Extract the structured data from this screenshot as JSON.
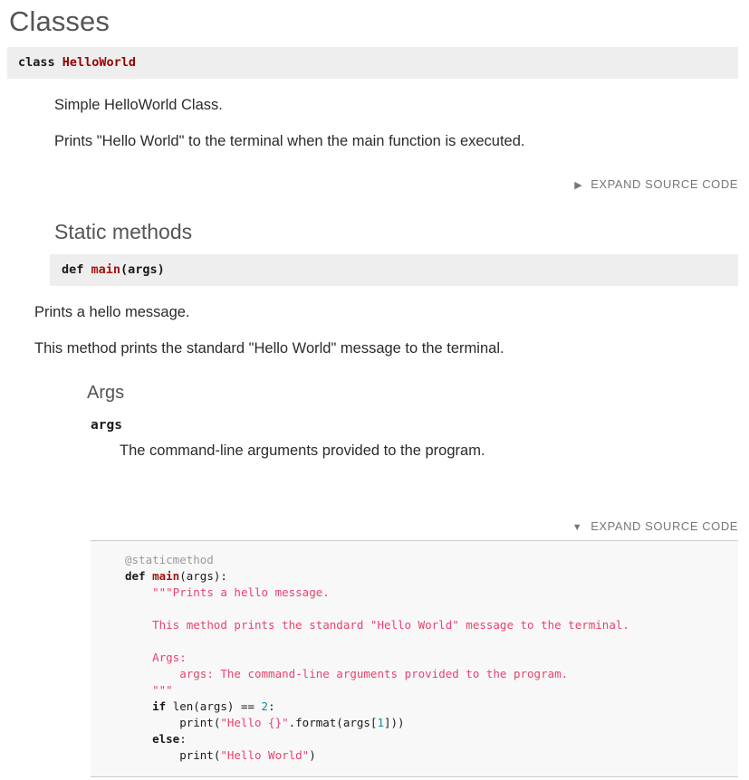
{
  "page": {
    "title": "Classes"
  },
  "class_entry": {
    "signature": {
      "keyword": "class",
      "name": "HelloWorld"
    },
    "descriptions": [
      "Simple HelloWorld Class.",
      "Prints \"Hello World\" to the terminal when the main function is executed."
    ],
    "expand_toggle": {
      "label": "EXPAND SOURCE CODE",
      "triangle": "collapsed-triangle-icon",
      "glyph": "▶",
      "expanded": false
    }
  },
  "static_methods": {
    "heading": "Static methods",
    "method": {
      "signature": {
        "keyword": "def",
        "name": "main",
        "params": "(args)"
      },
      "descriptions": [
        "Prints a hello message.",
        "This method prints the standard \"Hello World\" message to the terminal."
      ],
      "args_heading": "Args",
      "args": [
        {
          "name": "args",
          "description": "The command-line arguments provided to the program."
        }
      ],
      "expand_toggle": {
        "label": "EXPAND SOURCE CODE",
        "triangle": "expanded-triangle-icon",
        "glyph": "▼",
        "expanded": true
      },
      "source_code": {
        "lines": [
          {
            "tokens": [
              {
                "t": "@staticmethod",
                "c": "decorator"
              }
            ]
          },
          {
            "tokens": [
              {
                "t": "def ",
                "c": "kw"
              },
              {
                "t": "main",
                "c": "fn"
              },
              {
                "t": "(args):",
                "c": "plain"
              }
            ]
          },
          {
            "tokens": [
              {
                "t": "    ",
                "c": "plain"
              },
              {
                "t": "\"\"\"Prints a hello message.",
                "c": "doc"
              }
            ]
          },
          {
            "tokens": [
              {
                "t": "",
                "c": "plain"
              }
            ]
          },
          {
            "tokens": [
              {
                "t": "    ",
                "c": "plain"
              },
              {
                "t": "This method prints the standard \"Hello World\" message to the terminal.",
                "c": "doc"
              }
            ]
          },
          {
            "tokens": [
              {
                "t": "",
                "c": "plain"
              }
            ]
          },
          {
            "tokens": [
              {
                "t": "    ",
                "c": "plain"
              },
              {
                "t": "Args:",
                "c": "doc"
              }
            ]
          },
          {
            "tokens": [
              {
                "t": "        ",
                "c": "plain"
              },
              {
                "t": "args: The command-line arguments provided to the program.",
                "c": "doc"
              }
            ]
          },
          {
            "tokens": [
              {
                "t": "    ",
                "c": "plain"
              },
              {
                "t": "\"\"\"",
                "c": "doc"
              }
            ]
          },
          {
            "tokens": [
              {
                "t": "    ",
                "c": "plain"
              },
              {
                "t": "if ",
                "c": "kw"
              },
              {
                "t": "len(args) == ",
                "c": "plain"
              },
              {
                "t": "2",
                "c": "num"
              },
              {
                "t": ":",
                "c": "plain"
              }
            ]
          },
          {
            "tokens": [
              {
                "t": "        print(",
                "c": "plain"
              },
              {
                "t": "\"Hello {}\"",
                "c": "str"
              },
              {
                "t": ".format(args[",
                "c": "plain"
              },
              {
                "t": "1",
                "c": "num"
              },
              {
                "t": "]))",
                "c": "plain"
              }
            ]
          },
          {
            "tokens": [
              {
                "t": "    ",
                "c": "plain"
              },
              {
                "t": "else",
                "c": "kw"
              },
              {
                "t": ":",
                "c": "plain"
              }
            ]
          },
          {
            "tokens": [
              {
                "t": "        print(",
                "c": "plain"
              },
              {
                "t": "\"Hello World\"",
                "c": "str"
              },
              {
                "t": ")",
                "c": "plain"
              }
            ]
          }
        ]
      }
    }
  }
}
